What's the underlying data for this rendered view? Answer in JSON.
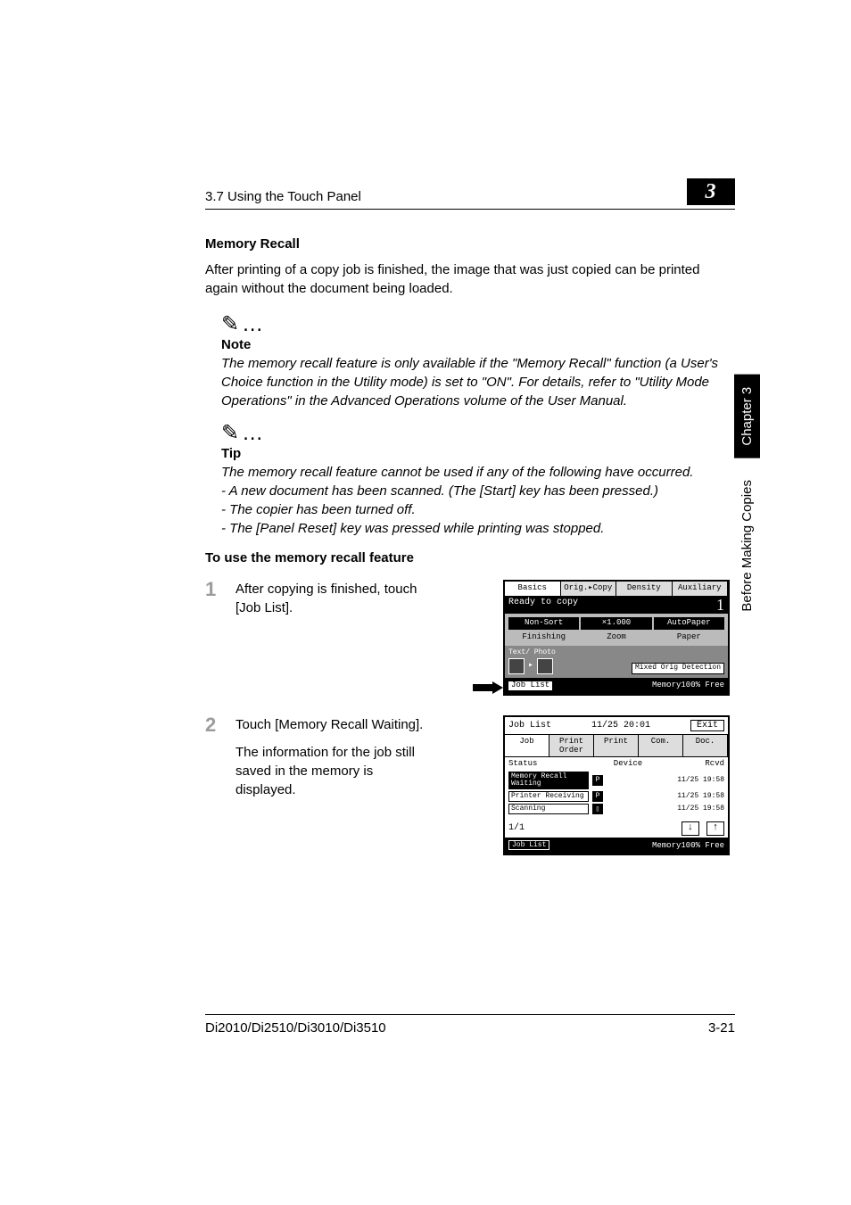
{
  "header": {
    "section_ref": "3.7 Using the Touch Panel",
    "chapter_badge": "3"
  },
  "sideTab": {
    "chapter": "Chapter 3",
    "title": "Before Making Copies"
  },
  "section": {
    "title": "Memory Recall",
    "intro": "After printing of a copy job is finished, the image that was just copied can be printed again without the document being loaded."
  },
  "note": {
    "label": "Note",
    "body": "The memory recall feature is only available if the \"Memory Recall\" function (a User's Choice function in the Utility mode) is set to \"ON\". For details, refer to \"Utility Mode Operations\" in the Advanced Operations volume of the User Manual."
  },
  "tip": {
    "label": "Tip",
    "lead": "The memory recall feature cannot be used if any of the following have occurred.",
    "items": [
      "- A new document has been scanned. (The [Start] key has been pressed.)",
      "- The copier has been turned off.",
      "- The [Panel Reset] key was pressed while printing was stopped."
    ]
  },
  "procedure": {
    "heading": "To use the memory recall feature",
    "steps": [
      {
        "num": "1",
        "text": "After copying is finished, touch [Job List]."
      },
      {
        "num": "2",
        "text": "Touch [Memory Recall Waiting].",
        "text2": "The information for the job still saved in the memory is displayed."
      }
    ]
  },
  "figure1": {
    "tabs": [
      "Basics",
      "Orig.▸Copy",
      "Density",
      "Auxiliary"
    ],
    "status": "Ready to copy",
    "count": "1",
    "buttons": [
      "Non-Sort",
      "×1.000",
      "AutoPaper"
    ],
    "labels": [
      "Finishing",
      "Zoom",
      "Paper"
    ],
    "textphoto": "Text/\nPhoto",
    "mixed": "Mixed Orig\nDetection",
    "joblist": "Job List",
    "memory": "Memory100%\nFree"
  },
  "figure2": {
    "title": "Job List",
    "datetime": "11/25 20:01",
    "exit": "Exit",
    "tabs": [
      "Job",
      "Print Order",
      "Print",
      "Com.",
      "Doc."
    ],
    "headers": [
      "Status",
      "Device",
      "Rcvd"
    ],
    "rows": [
      {
        "name": "Memory Recall\nWaiting",
        "icon": "P",
        "time": "11/25\n19:58",
        "inv": true
      },
      {
        "name": "Printer\nReceiving",
        "icon": "P",
        "time": "11/25\n19:58",
        "inv": false
      },
      {
        "name": "Scanning",
        "icon": "▯",
        "time": "11/25\n19:58",
        "inv": false
      }
    ],
    "page": "1/1",
    "joblist": "Job List",
    "memory": "Memory100%\nFree"
  },
  "footer": {
    "model": "Di2010/Di2510/Di3010/Di3510",
    "page": "3-21"
  }
}
